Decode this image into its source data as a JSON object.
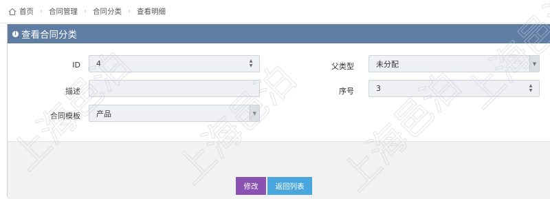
{
  "breadcrumb": {
    "items": [
      "首页",
      "合同管理",
      "合同分类",
      "查看明细"
    ],
    "separator": "›"
  },
  "panel": {
    "title": "查看合同分类"
  },
  "form": {
    "id_label": "ID",
    "id_value": "4",
    "parent_type_label": "父类型",
    "parent_type_value": "未分配",
    "description_label": "描述",
    "description_value": "",
    "order_label": "序号",
    "order_value": "3",
    "template_label": "合同模板",
    "template_value": "产品"
  },
  "actions": {
    "edit_label": "修改",
    "back_label": "返回列表"
  },
  "watermark": {
    "text": "上海邑泊"
  },
  "colors": {
    "header": "#5f7da3",
    "edit_button": "#8a53b3",
    "back_button": "#4aa7de"
  }
}
